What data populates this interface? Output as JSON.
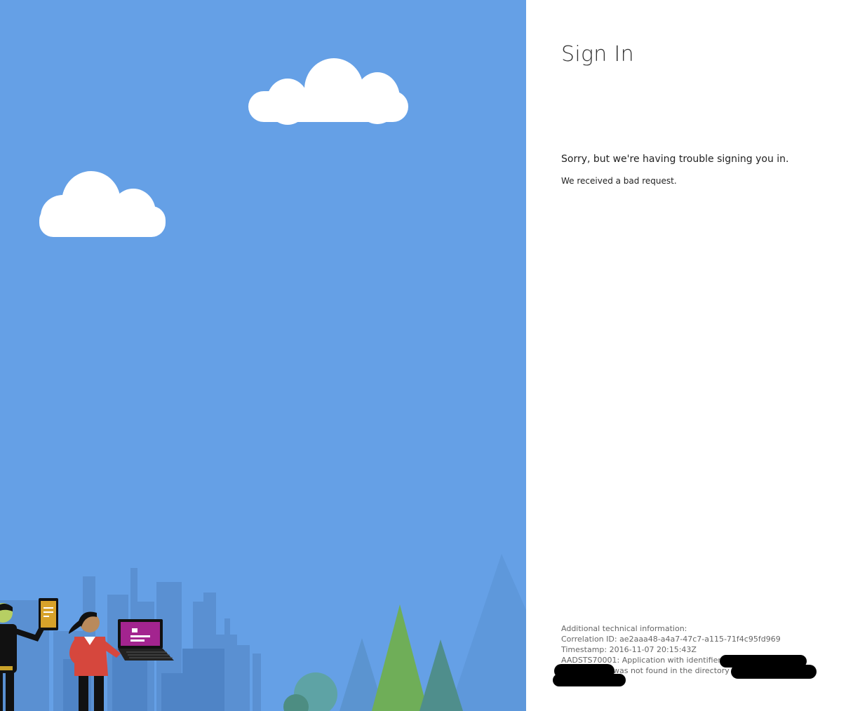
{
  "window": {
    "title": "Sign In"
  },
  "signin": {
    "title": "Sign In",
    "error_message": "Sorry, but we're having trouble signing you in.",
    "error_detail": "We received a bad request."
  },
  "tech_info": {
    "heading": "Additional technical information:",
    "correlation": "Correlation ID: ae2aaa48-a4a7-47c7-a115-71f4c95fd969",
    "timestamp": "Timestamp: 2016-11-07 20:15:43Z",
    "error_line1": "AADSTS70001: Application with identifier 'd17",
    "error_line2": "was not found in the directory ba8"
  },
  "colors": {
    "sky": "#65a0e6",
    "background": "#ffffff",
    "cloud": "#ffffff",
    "redaction": "#000000"
  },
  "illustration": {
    "clouds": 2,
    "people": [
      "person-with-tablet",
      "person-with-laptop"
    ]
  }
}
